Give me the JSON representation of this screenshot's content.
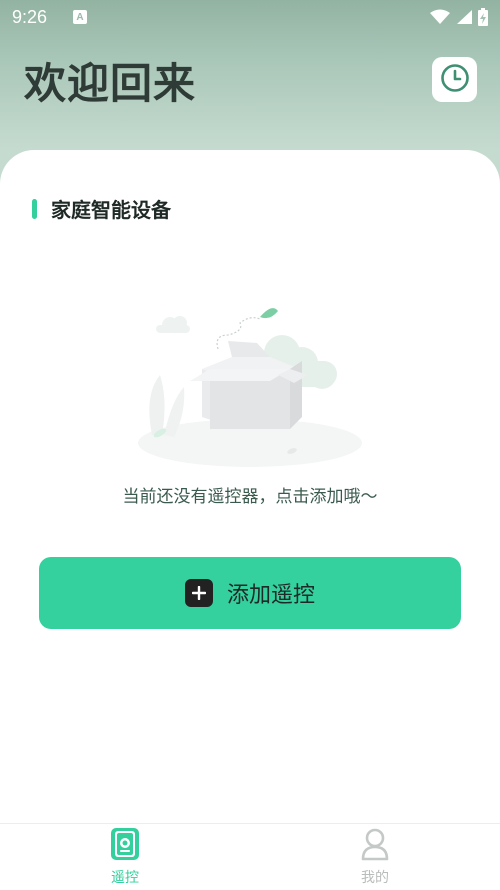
{
  "status_bar": {
    "time": "9:26",
    "notification_icon_letter": "A",
    "icons": [
      "wifi-icon",
      "signal-icon",
      "battery-charging-icon"
    ]
  },
  "header": {
    "title": "欢迎回来",
    "history_icon": "clock-icon"
  },
  "section": {
    "title": "家庭智能设备"
  },
  "empty_state": {
    "illustration": "empty-box-illustration",
    "message": "当前还没有遥控器，点击添加哦～"
  },
  "add_button": {
    "label": "添加遥控",
    "icon": "plus-icon"
  },
  "bottom_nav": {
    "items": [
      {
        "label": "遥控",
        "icon": "remote-icon",
        "active": true
      },
      {
        "label": "我的",
        "icon": "profile-icon",
        "active": false
      }
    ]
  },
  "colors": {
    "accent": "#34d09e",
    "header_gradient_top": "#93b3a2",
    "title_text": "#2f3b36",
    "inactive_nav": "#b8bcbb"
  }
}
